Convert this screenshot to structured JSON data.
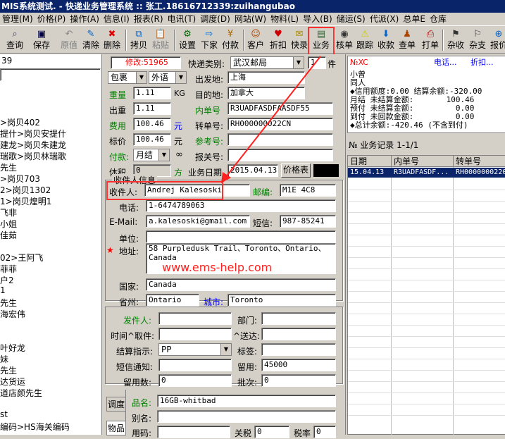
{
  "title": "MIS系统测试. - 快递业务管理系统 :: 张工.18616712339:zuihangubao",
  "menu": [
    "管理(M)",
    "价格(P)",
    "操作(A)",
    "信息(I)",
    "报表(R)",
    "电讯(T)",
    "调度(D)",
    "网站(W)",
    "物料(L)",
    "导入(B)",
    "储运(S)",
    "代派(X)",
    "总单E",
    "仓库"
  ],
  "toolbar": {
    "query": "查询",
    "save": "保存",
    "original": "原值",
    "clear": "清除",
    "delete": "删除",
    "copy": "拷贝",
    "paste": "粘贴",
    "settings": "设置",
    "next": "下家",
    "payment": "付款",
    "customer": "客户",
    "discount": "折扣",
    "quick_report": "快录",
    "business": "业务",
    "verify": "核单",
    "track": "跟踪",
    "receive": "收款",
    "check": "查单",
    "print": "打单",
    "misc_check": "杂收",
    "misc_pay": "杂支",
    "report": "报价"
  },
  "left": {
    "top_fragment": "39",
    "items": [
      ">岗贝402",
      "提什>岗贝安提什",
      "建龙>岗贝朱建龙",
      "瑞歌>岗贝林瑞歌",
      "先生",
      ">岗贝703",
      "2>岗贝1302",
      "1>岗贝煌明1",
      "飞非",
      "小姐",
      "佳茹",
      "02>王阿飞",
      "菲菲",
      "户2",
      "1",
      "先生",
      "海宏伟",
      "叶好龙",
      "妹",
      "先生",
      "达货运",
      "道店颜先生",
      "st",
      "编码>HS海关编码"
    ]
  },
  "form": {
    "modified": "修改:51965",
    "express_type_label": "快递类别:",
    "express_type": "武汉邮局",
    "pieces": "1",
    "pieces_unit": "件",
    "pkg_type": "包裹",
    "lang": "外语",
    "origin_label": "出发地:",
    "origin": "上海",
    "weight_label": "重量",
    "weight": "1.11",
    "weight_unit": "KG",
    "dest_label": "目的地:",
    "dest": "加拿大",
    "out_weight_label": "出重",
    "out_weight": "1.11",
    "inner_no_label": "内单号",
    "inner_no": "R3UADFASDFAASDF55",
    "fee_label": "费用",
    "fee": "100.46",
    "fee_unit": "元",
    "transfer_label": "转单号:",
    "transfer_no": "RH000000022CN",
    "price_label": "标价",
    "price": "100.46",
    "price_unit": "元",
    "ref_label": "参考号:",
    "pay_label": "付款:",
    "pay": "月结",
    "customs_label": "报关号:",
    "volume_label": "体积",
    "volume": "0",
    "volume_unit": "方",
    "date_label": "业务日期",
    "date": "2015.04.13",
    "price_table": "价格表",
    "recv_group": "收件人信息",
    "recv_name_label": "收件人:",
    "recv_name": "Andrej Kalesoski",
    "zip_label": "邮编:",
    "zip": "M1E 4C8",
    "phone_label": "电话:",
    "phone": "1-6474789063",
    "email_label": "E-Mail:",
    "email": "a.kalesoski@gmail.com",
    "sms_label": "短信:",
    "sms": "987-85241",
    "unit_label": "单位:",
    "addr_label": "地址:",
    "addr_line1": "58 Purpledusk Trail、Toronto、Ontario、",
    "addr_line2": "Canada",
    "required_mark": "★",
    "country_label": "国家:",
    "country": "Canada",
    "province_label": "省州:",
    "province": "Ontario",
    "city_label": "城市:",
    "city": "Toronto",
    "sender_label": "发件人:",
    "dept_label": "部门:",
    "time_label": "时间^取件:",
    "deliver_label": "^送达:",
    "settle_label": "结算指示:",
    "settle": "PP",
    "tag_label": "标签:",
    "sms_notify_label": "短信通知:",
    "keep_label": "留用:",
    "keep": "45000",
    "keep_days_label": "留用数:",
    "keep_days": "0",
    "batch_label": "批次:",
    "batch": "0",
    "tab_dispatch": "调度",
    "tab_goods": "物品",
    "goods_name_label": "品名:",
    "goods_name": "16GB-whitbad",
    "alias_label": "别名:",
    "code_label": "用码:",
    "customs_rate_label": "关税",
    "customs_rate": "0",
    "tax_label": "税率",
    "tax": "0"
  },
  "watermark": "www.ems-help.com",
  "right": {
    "code": "№XC",
    "links": [
      "电话...",
      "折扣..."
    ],
    "info_lines": [
      "小曾",
      "同人",
      "◆信用额度:0.00 结算余额:-320.00",
      "月结 未结算金额:       100.46",
      "预付 未结算金额:         0.00",
      "到付 未回款金额:         0.00",
      "◆总计余额:-420.46 (不含到付)"
    ],
    "records_title": "№ 业务记录 1-1/1",
    "cols": [
      "日期",
      "内单号",
      "转单号"
    ],
    "row": [
      "15.04.13",
      "R3UADFASDF...",
      "RH0000000220"
    ]
  }
}
